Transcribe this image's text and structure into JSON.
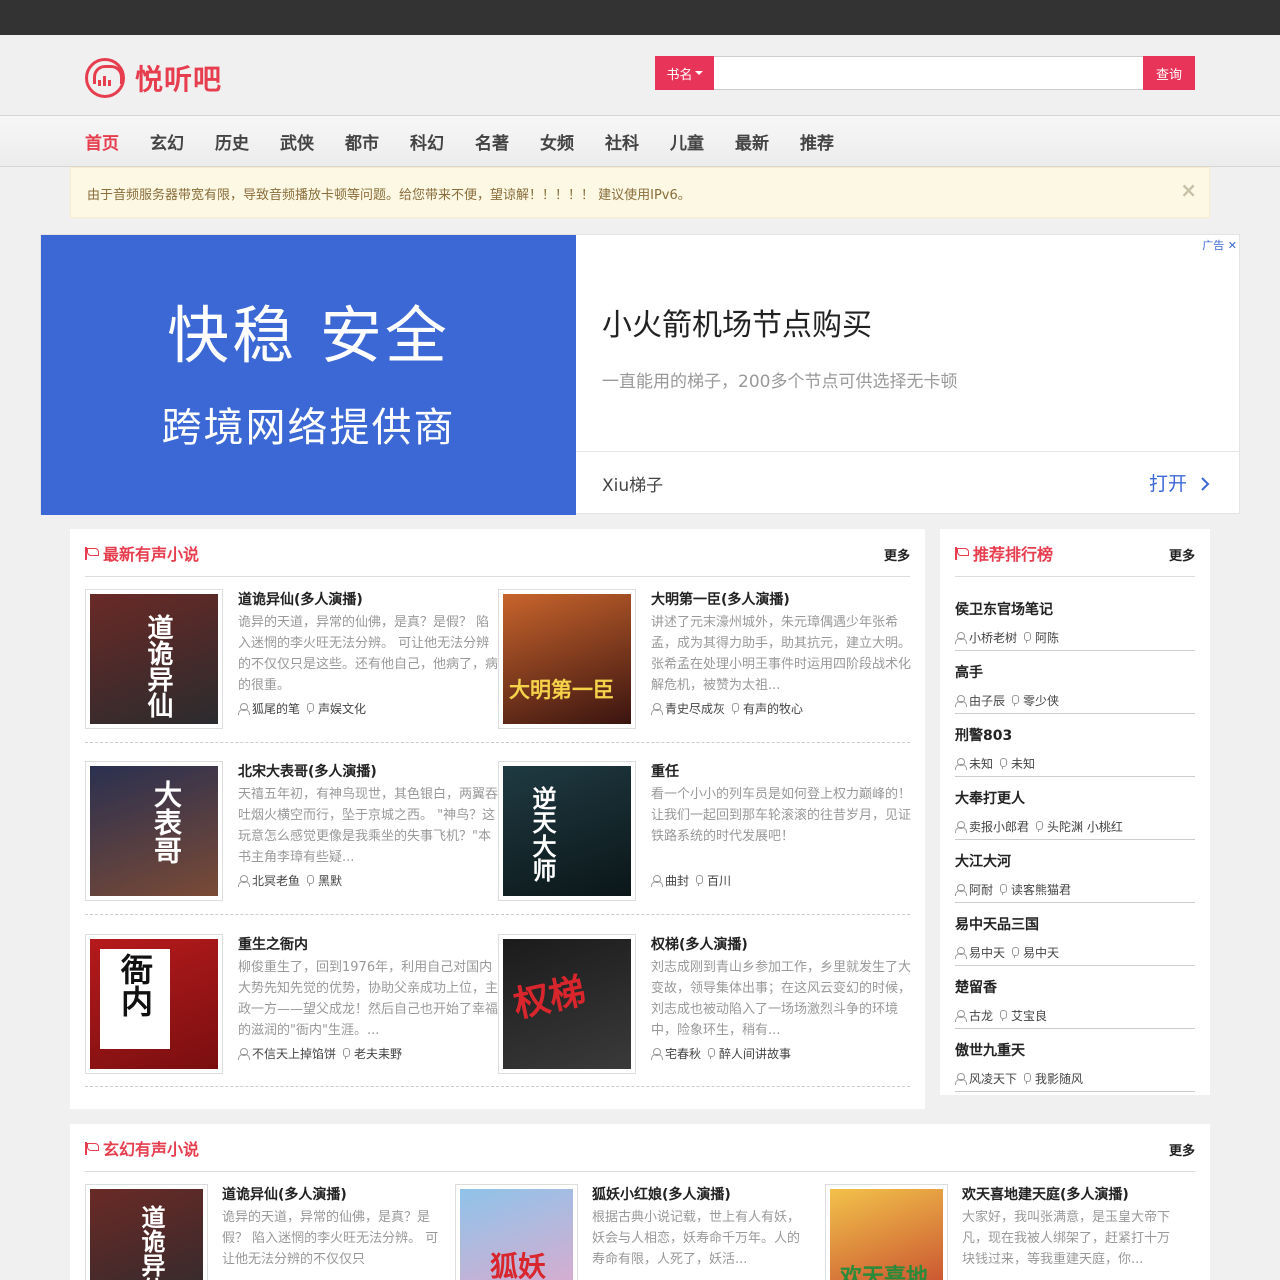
{
  "site": {
    "logo_text": "悦听吧",
    "brand_color": "#e63e4f"
  },
  "search": {
    "type_label": "书名",
    "placeholder": "",
    "button_label": "查询"
  },
  "nav": {
    "items": [
      "首页",
      "玄幻",
      "历史",
      "武侠",
      "都市",
      "科幻",
      "名著",
      "女频",
      "社科",
      "儿童",
      "最新",
      "推荐"
    ],
    "active_index": 0
  },
  "notice": {
    "text": "由于音频服务器带宽有限，导致音频播放卡顿等问题。给您带来不便，望谅解！！！！！ 建议使用IPv6。",
    "close": "×"
  },
  "ad": {
    "headline": "快稳 安全",
    "subline": "跨境网络提供商",
    "title": "小火箭机场节点购买",
    "desc": "一直能用的梯子，200多个节点可供选择无卡顿",
    "brand": "Xiu梯子",
    "open_label": "打开",
    "badge": "广告",
    "badge_close": "✕",
    "left_color": "#3c68d6"
  },
  "latest": {
    "title": "最新有声小说",
    "more": "更多",
    "books": [
      {
        "title": "道诡异仙(多人演播)",
        "desc": "诡异的天道，异常的仙佛，是真？是假？ 陷入迷惘的李火旺无法分辨。 可让他无法分辨的不仅仅只是这些。还有他自己，他病了，病的很重。",
        "author": "狐尾的笔",
        "narrator": "声娱文化",
        "cover_text": "道诡异仙",
        "cover_colors": [
          "#6a2a26",
          "#2b2b2e"
        ]
      },
      {
        "title": "大明第一臣(多人演播)",
        "desc": "讲述了元末濠州城外，朱元璋偶遇少年张希孟，成为其得力助手，助其抗元，建立大明。张希孟在处理小明王事件时运用四阶段战术化解危机，被赞为太祖...",
        "author": "青史尽成灰",
        "narrator": "有声的牧心",
        "cover_text": "大明第一臣",
        "cover_colors": [
          "#c8642c",
          "#3a1410"
        ]
      },
      {
        "title": "北宋大表哥(多人演播)",
        "desc": "天禧五年初，有神鸟现世，其色银白，两翼吞吐烟火横空而行，坠于京城之西。 \"神鸟？这玩意怎么感觉更像是我乘坐的失事飞机？\"本书主角李璋有些疑...",
        "author": "北冥老鱼",
        "narrator": "黑默",
        "cover_text": "大表哥",
        "cover_colors": [
          "#2a3050",
          "#7a4a36"
        ]
      },
      {
        "title": "重任",
        "desc": "看一个小小的列车员是如何登上权力巅峰的！ 让我们一起回到那车轮滚滚的往昔岁月，见证铁路系统的时代发展吧！",
        "author": "曲封",
        "narrator": "百川",
        "cover_text": "逆天大师",
        "cover_colors": [
          "#1f3a42",
          "#0b1618"
        ]
      },
      {
        "title": "重生之衙内",
        "desc": "柳俊重生了，回到1976年，利用自己对国内大势先知先觉的优势，协助父亲成功上位，主政一方——望父成龙！然后自己也开始了幸福的滋润的\"衙内\"生涯。...",
        "author": "不信天上掉馅饼",
        "narrator": "老夫耒野",
        "cover_text": "衙内",
        "cover_colors": [
          "#b61a1c",
          "#7a0f10"
        ]
      },
      {
        "title": "权梯(多人演播)",
        "desc": "刘志成刚到青山乡参加工作，乡里就发生了大变故，领导集体出事；在这风云变幻的时候，刘志成也被动陷入了一场场激烈斗争的环境中，险象环生，稍有...",
        "author": "宅春秋",
        "narrator": "醉人间讲故事",
        "cover_text": "权梯",
        "cover_colors": [
          "#1b1b1b",
          "#3a3a3a"
        ]
      }
    ]
  },
  "ranking": {
    "title": "推荐排行榜",
    "more": "更多",
    "items": [
      {
        "title": "侯卫东官场笔记",
        "author": "小桥老树",
        "narrator": "阿陈"
      },
      {
        "title": "高手",
        "author": "由子辰",
        "narrator": "零少侠"
      },
      {
        "title": "刑警803",
        "author": "未知",
        "narrator": "未知"
      },
      {
        "title": "大奉打更人",
        "author": "卖报小郎君",
        "narrator": "头陀渊 小桃红"
      },
      {
        "title": "大江大河",
        "author": "阿耐",
        "narrator": "读客熊猫君"
      },
      {
        "title": "易中天品三国",
        "author": "易中天",
        "narrator": "易中天"
      },
      {
        "title": "楚留香",
        "author": "古龙",
        "narrator": "艾宝良"
      },
      {
        "title": "傲世九重天",
        "author": "风凌天下",
        "narrator": "我影随风"
      }
    ]
  },
  "xuanhuan": {
    "title": "玄幻有声小说",
    "more": "更多",
    "books": [
      {
        "title": "道诡异仙(多人演播)",
        "desc": "诡异的天道，异常的仙佛，是真？是假？ 陷入迷惘的李火旺无法分辨。 可让他无法分辨的不仅仅只",
        "cover_text": "道诡异仙",
        "cover_colors": [
          "#6a2a26",
          "#2b2b2e"
        ]
      },
      {
        "title": "狐妖小红娘(多人演播)",
        "desc": "根据古典小说记载，世上有人有妖，妖会与人相恋，妖寿命千万年。人的寿命有限，人死了，妖活...",
        "cover_text": "狐妖",
        "cover_colors": [
          "#e9a7c9",
          "#8fc3ea"
        ]
      },
      {
        "title": "欢天喜地建天庭(多人演播)",
        "desc": "大家好，我叫张满意，是玉皇大帝下凡，现在我被人绑架了，赶紧打十万块钱过来，等我重建天庭，你...",
        "cover_text": "欢天喜地",
        "cover_colors": [
          "#f2c24a",
          "#c0392b"
        ]
      }
    ]
  }
}
